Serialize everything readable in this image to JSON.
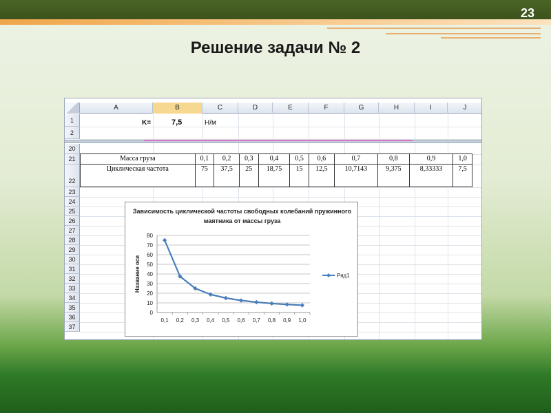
{
  "slide": {
    "page_number": "23",
    "title": "Решение задачи № 2"
  },
  "sheet": {
    "columns": [
      "A",
      "B",
      "C",
      "D",
      "E",
      "F",
      "G",
      "H",
      "I",
      "J"
    ],
    "top_rows": [
      "1",
      "2"
    ],
    "bottom_rows": [
      "20",
      "21",
      "22",
      "23",
      "24",
      "25",
      "26",
      "27",
      "28",
      "29",
      "30",
      "31",
      "32",
      "33",
      "34",
      "35",
      "36",
      "37"
    ],
    "k_label": "K=",
    "k_value": "7,5",
    "k_unit": "Н/м"
  },
  "table": {
    "row1_label": "Масса груза",
    "row2_label": "Циклическая частота",
    "masses": [
      "0,1",
      "0,2",
      "0,3",
      "0,4",
      "0,5",
      "0,6",
      "0,7",
      "0,8",
      "0,9",
      "1,0"
    ],
    "frequencies": [
      "75",
      "37,5",
      "25",
      "18,75",
      "15",
      "12,5",
      "10,7143",
      "9,375",
      "8,33333",
      "7,5"
    ]
  },
  "chart_data": {
    "type": "line",
    "title": "Зависимость циклической частоты свободных колебаний пружинного маятника от массы груза",
    "xlabel": "",
    "ylabel": "Название оси",
    "categories": [
      "0,1",
      "0,2",
      "0,3",
      "0,4",
      "0,5",
      "0,6",
      "0,7",
      "0,8",
      "0,9",
      "1,0"
    ],
    "series": [
      {
        "name": "Ряд1",
        "values": [
          75,
          37.5,
          25,
          18.75,
          15,
          12.5,
          10.7143,
          9.375,
          8.33333,
          7.5
        ]
      }
    ],
    "ylim": [
      0,
      80
    ],
    "yticks": [
      0,
      10,
      20,
      30,
      40,
      50,
      60,
      70,
      80
    ],
    "grid": true,
    "legend": "right",
    "line_color": "#4a7ebb"
  }
}
